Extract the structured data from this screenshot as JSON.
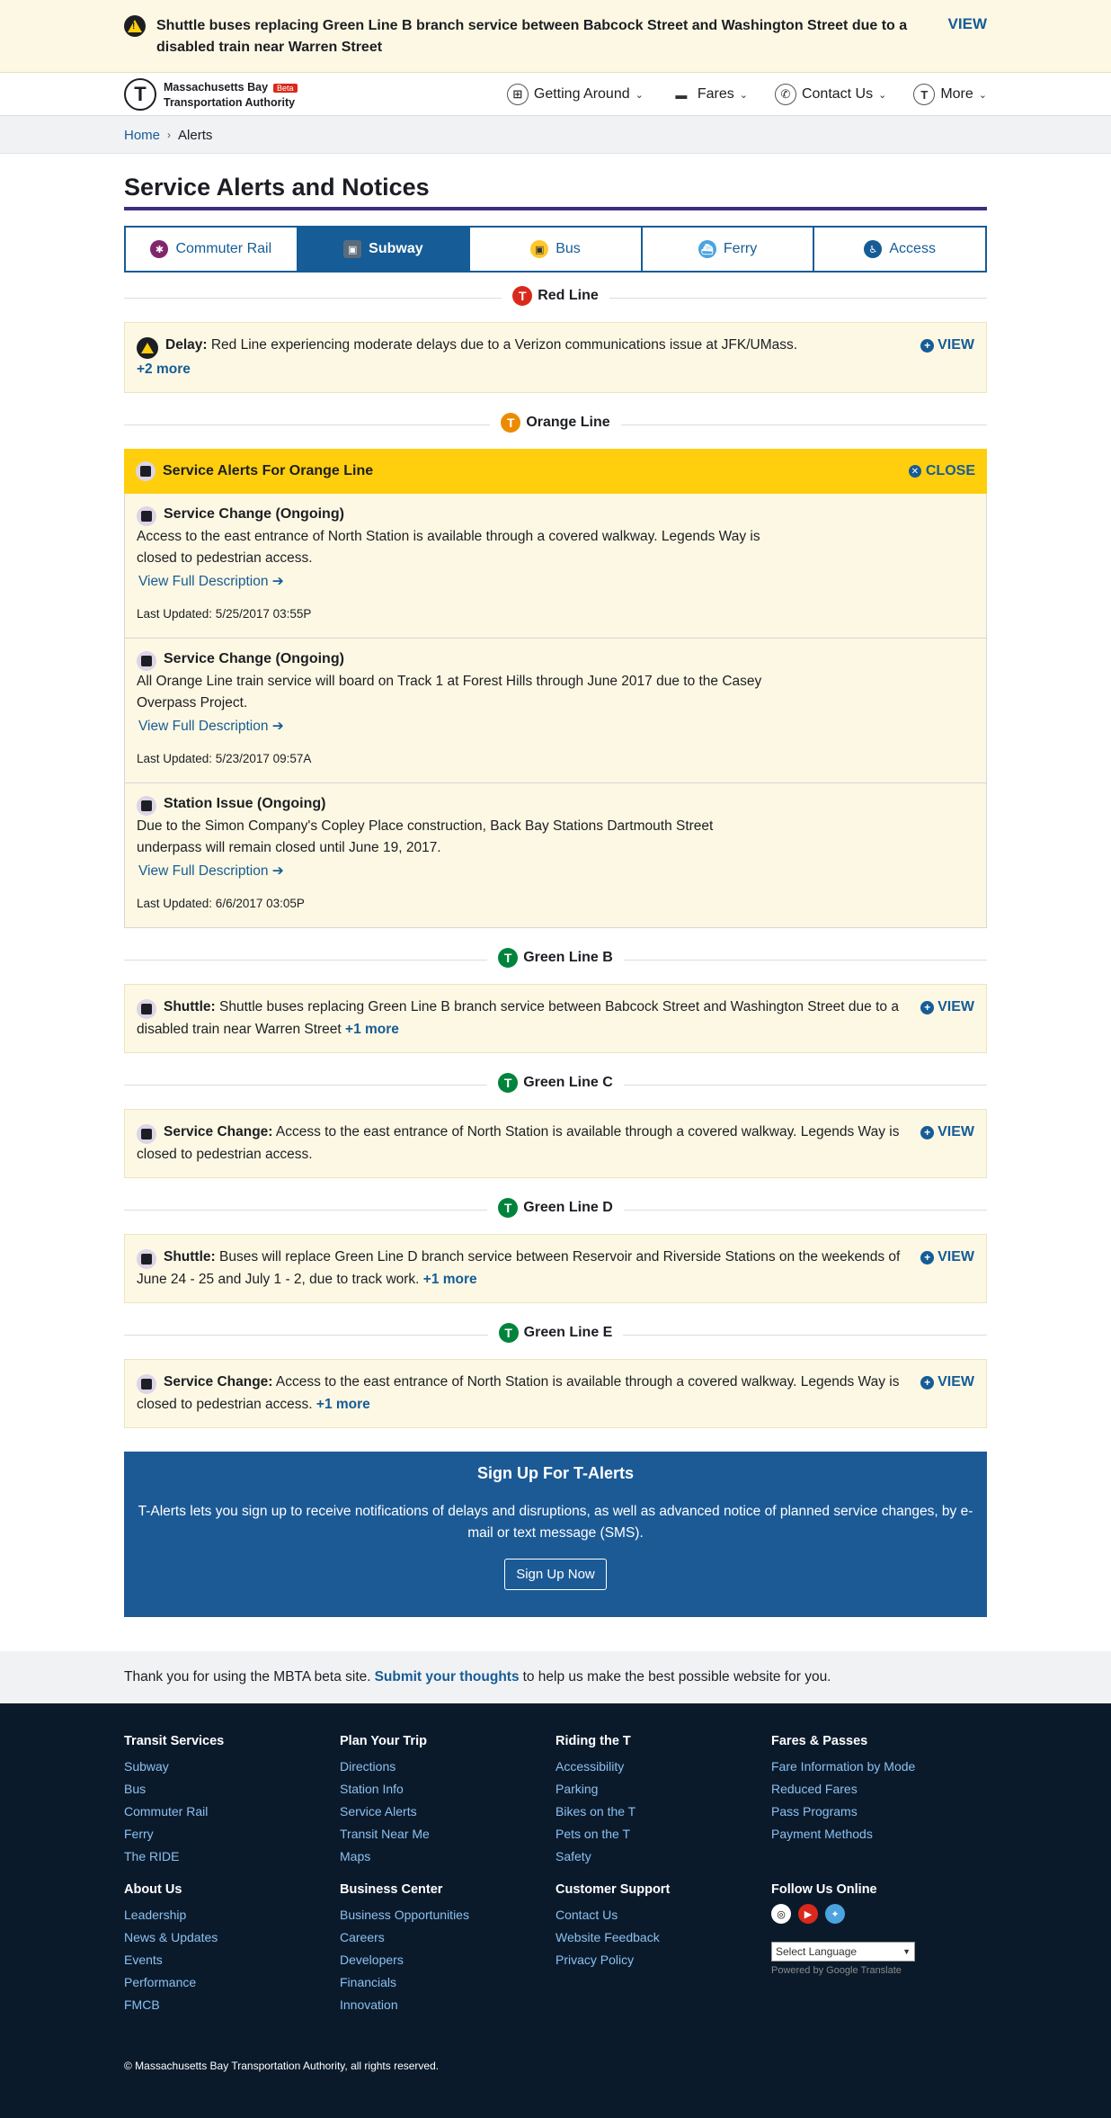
{
  "top_banner": {
    "message": "Shuttle buses replacing Green Line B branch service between Babcock Street and Washington Street due to a disabled train near Warren Street",
    "view_label": "VIEW"
  },
  "header": {
    "org_line1": "Massachusetts Bay",
    "org_line2": "Transportation Authority",
    "beta": "Beta",
    "nav": [
      "Getting Around",
      "Fares",
      "Contact Us",
      "More"
    ]
  },
  "breadcrumb": {
    "home": "Home",
    "current": "Alerts"
  },
  "page_title": "Service Alerts and Notices",
  "tabs": [
    "Commuter Rail",
    "Subway",
    "Bus",
    "Ferry",
    "Access"
  ],
  "colors": {
    "red": "#da291c",
    "orange": "#ed8b00",
    "green": "#00843d",
    "blue": "#165c96",
    "purple": "#80276c",
    "yellow": "#ffce0c"
  },
  "red_line": {
    "name": "Red Line",
    "alert_type": "Delay:",
    "alert_text": "Red Line experiencing moderate delays due to a Verizon communications issue at JFK/UMass.",
    "more": "+2 more",
    "view": "VIEW"
  },
  "orange_line": {
    "name": "Orange Line",
    "header": "Service Alerts For Orange Line",
    "close": "CLOSE",
    "full_desc": "View Full Description",
    "items": [
      {
        "title": "Service Change (Ongoing)",
        "desc": "Access to the east entrance of North Station is available through a covered walkway. Legends Way is closed to pedestrian access.",
        "updated": "Last Updated: 5/25/2017 03:55P"
      },
      {
        "title": "Service Change (Ongoing)",
        "desc": "All Orange Line train service will board on Track 1 at Forest Hills through June 2017 due to the Casey Overpass Project.",
        "updated": "Last Updated: 5/23/2017 09:57A"
      },
      {
        "title": "Station Issue (Ongoing)",
        "desc": "Due to the Simon Company's Copley Place construction, Back Bay Stations Dartmouth Street underpass will remain closed until June 19, 2017.",
        "updated": "Last Updated: 6/6/2017 03:05P"
      }
    ]
  },
  "green_b": {
    "name": "Green Line B",
    "type": "Shuttle:",
    "text": "Shuttle buses replacing Green Line B branch service between Babcock Street and Washington Street due to a disabled train near Warren Street",
    "more": "+1 more",
    "view": "VIEW"
  },
  "green_c": {
    "name": "Green Line C",
    "type": "Service Change:",
    "text": "Access to the east entrance of North Station is available through a covered walkway. Legends Way is closed to pedestrian access.",
    "view": "VIEW"
  },
  "green_d": {
    "name": "Green Line D",
    "type": "Shuttle:",
    "text": "Buses will replace Green Line D branch service between Reservoir and Riverside Stations on the weekends of June 24 - 25 and July 1 - 2, due to track work.",
    "more": "+1 more",
    "view": "VIEW"
  },
  "green_e": {
    "name": "Green Line E",
    "type": "Service Change:",
    "text": "Access to the east entrance of North Station is available through a covered walkway. Legends Way is closed to pedestrian access.",
    "more": "+1 more",
    "view": "VIEW"
  },
  "signup": {
    "title": "Sign Up For T-Alerts",
    "text": "T-Alerts lets you sign up to receive notifications of delays and disruptions, as well as advanced notice of planned service changes, by e-mail or text message (SMS).",
    "button": "Sign Up Now"
  },
  "feedback": {
    "pre": "Thank you for using the MBTA beta site.",
    "link": "Submit your thoughts",
    "post": "to help us make the best possible website for you."
  },
  "footer": {
    "transit": {
      "title": "Transit Services",
      "links": [
        "Subway",
        "Bus",
        "Commuter Rail",
        "Ferry",
        "The RIDE"
      ]
    },
    "plan": {
      "title": "Plan Your Trip",
      "links": [
        "Directions",
        "Station Info",
        "Service Alerts",
        "Transit Near Me",
        "Maps"
      ]
    },
    "riding": {
      "title": "Riding the T",
      "links": [
        "Accessibility",
        "Parking",
        "Bikes on the T",
        "Pets on the T",
        "Safety"
      ]
    },
    "fares": {
      "title": "Fares & Passes",
      "links": [
        "Fare Information by Mode",
        "Reduced Fares",
        "Pass Programs",
        "Payment Methods"
      ]
    },
    "about": {
      "title": "About Us",
      "links": [
        "Leadership",
        "News & Updates",
        "Events",
        "Performance",
        "FMCB"
      ]
    },
    "business": {
      "title": "Business Center",
      "links": [
        "Business Opportunities",
        "Careers",
        "Developers",
        "Financials",
        "Innovation"
      ]
    },
    "support": {
      "title": "Customer Support",
      "links": [
        "Contact Us",
        "Website Feedback",
        "Privacy Policy"
      ]
    },
    "follow": {
      "title": "Follow Us Online"
    },
    "language": "Select Language",
    "powered": "Powered by Google Translate",
    "copyright": "© Massachusetts Bay Transportation Authority, all rights reserved."
  }
}
